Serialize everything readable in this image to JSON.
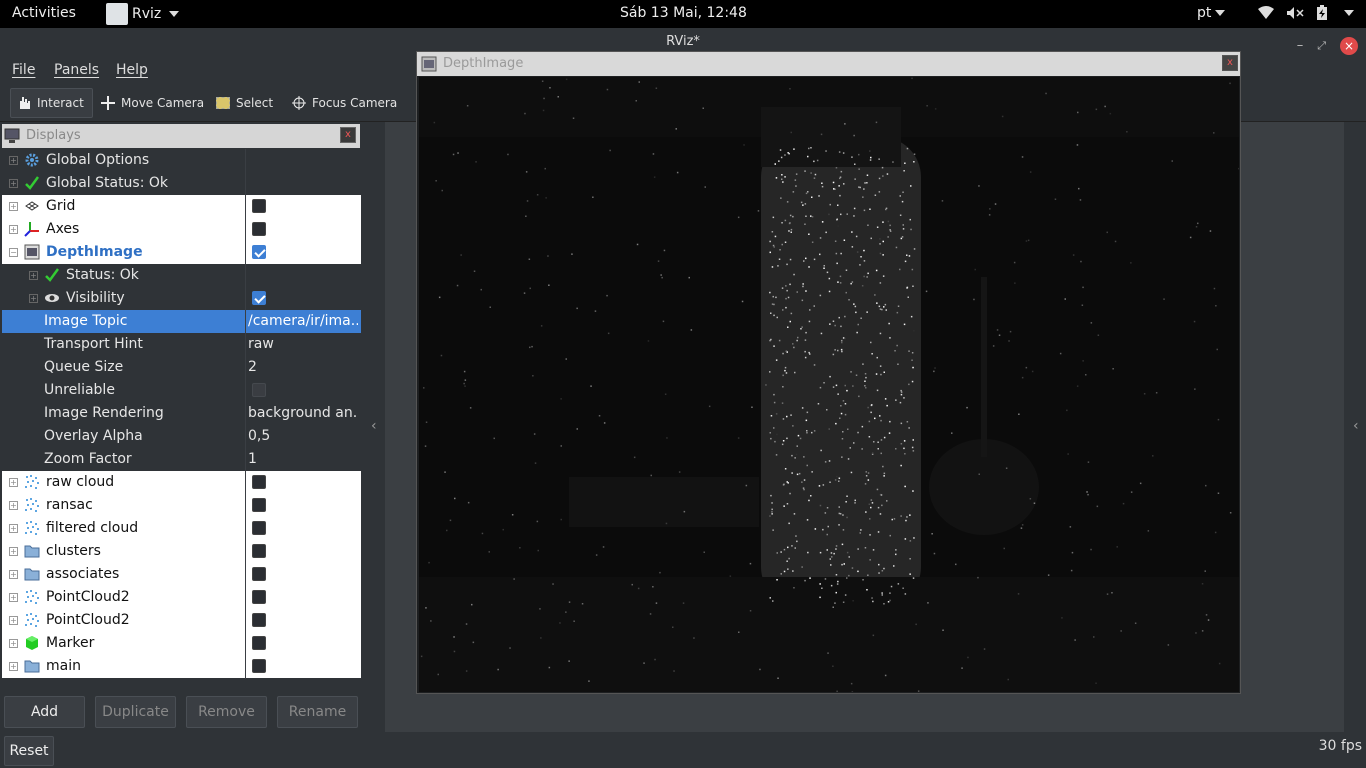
{
  "topbar": {
    "activities": "Activities",
    "app_name": "Rviz",
    "clock": "Sáb 13 Mai, 12:48",
    "lang": "pt"
  },
  "window": {
    "title": "RViz*"
  },
  "menu": {
    "file": "File",
    "panels": "Panels",
    "help": "Help"
  },
  "toolbar": {
    "interact": "Interact",
    "move_camera": "Move Camera",
    "select": "Select",
    "focus_camera": "Focus Camera"
  },
  "displays": {
    "title": "Displays",
    "rows": [
      {
        "name": "Global Options",
        "icon": "gear-icon"
      },
      {
        "name": "Global Status: Ok",
        "icon": "check-icon"
      },
      {
        "name": "Grid",
        "icon": "grid-icon",
        "checked": false
      },
      {
        "name": "Axes",
        "icon": "axes-icon",
        "checked": false
      },
      {
        "name": "DepthImage",
        "icon": "image-icon",
        "checked": true
      },
      {
        "name": "Status: Ok",
        "icon": "check-icon"
      },
      {
        "name": "Visibility",
        "icon": "eye-icon",
        "checked": true
      },
      {
        "name": "Image Topic",
        "value": "/camera/ir/ima..."
      },
      {
        "name": "Transport Hint",
        "value": "raw"
      },
      {
        "name": "Queue Size",
        "value": "2"
      },
      {
        "name": "Unreliable",
        "checked": false
      },
      {
        "name": "Image Rendering",
        "value": "background an..."
      },
      {
        "name": "Overlay Alpha",
        "value": "0,5"
      },
      {
        "name": "Zoom Factor",
        "value": "1"
      },
      {
        "name": "raw cloud",
        "icon": "pointcloud-icon",
        "checked": false
      },
      {
        "name": "ransac",
        "icon": "pointcloud-icon",
        "checked": false
      },
      {
        "name": "filtered cloud",
        "icon": "pointcloud-icon",
        "checked": false
      },
      {
        "name": "clusters",
        "icon": "folder-icon",
        "checked": false
      },
      {
        "name": "associates",
        "icon": "folder-icon",
        "checked": false
      },
      {
        "name": "PointCloud2",
        "icon": "pointcloud-icon",
        "checked": false
      },
      {
        "name": "PointCloud2",
        "icon": "pointcloud-icon",
        "checked": false
      },
      {
        "name": "Marker",
        "icon": "cube-icon",
        "checked": false
      },
      {
        "name": "main",
        "icon": "folder-icon",
        "checked": false
      }
    ],
    "buttons": {
      "add": "Add",
      "duplicate": "Duplicate",
      "remove": "Remove",
      "rename": "Rename"
    }
  },
  "image_panel": {
    "title": "DepthImage"
  },
  "status": {
    "reset": "Reset",
    "fps": "30 fps"
  },
  "colors": {
    "selection": "#3d7fd4",
    "background": "#2f3337"
  }
}
